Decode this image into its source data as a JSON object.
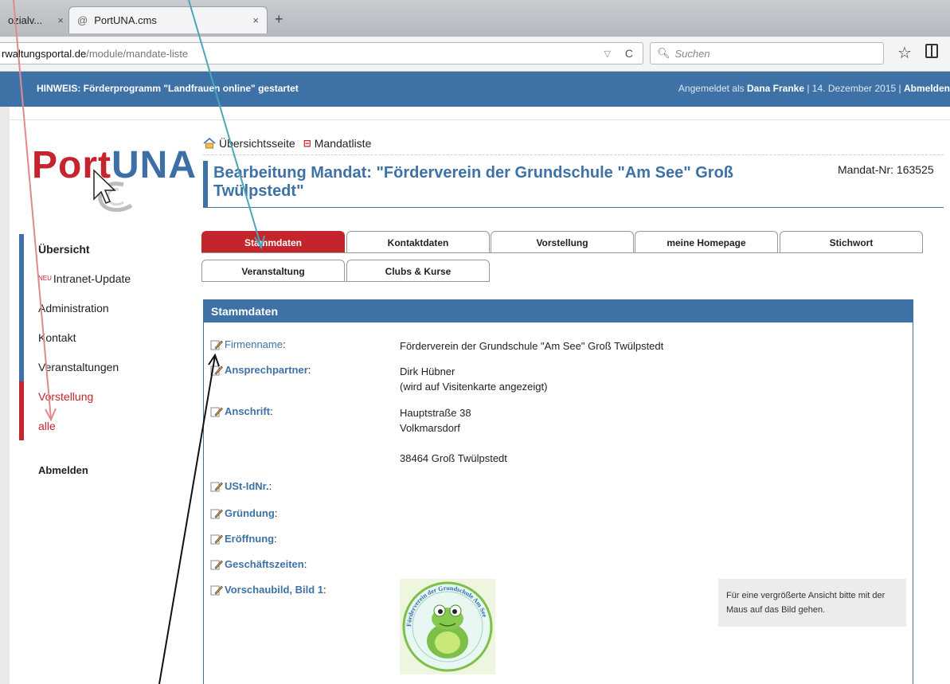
{
  "browser": {
    "tabs": [
      {
        "title": "ozialv...",
        "close": "×"
      },
      {
        "title": "PortUNA.cms",
        "close": "×"
      }
    ],
    "new_tab": "+",
    "url_host": "rwaltungsportal.de",
    "url_path": "/module/mandate-liste",
    "search_placeholder": "Suchen"
  },
  "notice": {
    "hint": "HINWEIS:  Förderprogramm \"Landfrauen online\" gestartet",
    "login_prefix": "Angemeldet als ",
    "user": "Dana Franke",
    "date_sep": " | 14. Dezember 2015 | ",
    "logout": "Abmelden"
  },
  "logo": {
    "part1": "Port",
    "part2": "UNA"
  },
  "nav": {
    "items": [
      {
        "label": "Übersicht"
      },
      {
        "label": "Intranet-Update",
        "badge": "NEU"
      },
      {
        "label": "Administration"
      },
      {
        "label": "Kontakt"
      },
      {
        "label": "Veranstaltungen"
      },
      {
        "label": "Vorstellung"
      },
      {
        "label": "alle"
      }
    ],
    "logout": "Abmelden"
  },
  "breadcrumb": {
    "home": "Übersichtsseite",
    "list": "Mandatliste"
  },
  "page": {
    "title": "Bearbeitung Mandat: \"Förderverein der Grundschule \"Am See\" Groß Twülpstedt\"",
    "mandat_nr": "Mandat-Nr: 163525"
  },
  "tabs": [
    "Stammdaten",
    "Kontaktdaten",
    "Vorstellung",
    "meine Homepage",
    "Stichwort",
    "Veranstaltung",
    "Clubs & Kurse"
  ],
  "panel": {
    "title": "Stammdaten",
    "fields": [
      {
        "label": "Firmenname",
        "value": "Förderverein der Grundschule \"Am See\" Groß Twülpstedt"
      },
      {
        "label": "Ansprechpartner",
        "value1": "Dirk Hübner",
        "value2": "(wird auf Visitenkarte angezeigt)"
      },
      {
        "label": "Anschrift",
        "value1": "Hauptstraße 38",
        "value2": "Volkmarsdorf",
        "value3": "38464 Groß Twülpstedt"
      },
      {
        "label": "USt-IdNr."
      },
      {
        "label": "Gründung"
      },
      {
        "label": "Eröffnung"
      },
      {
        "label": "Geschäftszeiten"
      },
      {
        "label": "Vorschaubild, Bild 1"
      }
    ],
    "colon": ":",
    "hint": "Für eine vergrößerte Ansicht bitte mit der Maus auf das Bild gehen.",
    "image_text": "Förderverein der Grundschule Am See"
  },
  "colors": {
    "blue": "#3e72a6",
    "red": "#c4242b"
  }
}
